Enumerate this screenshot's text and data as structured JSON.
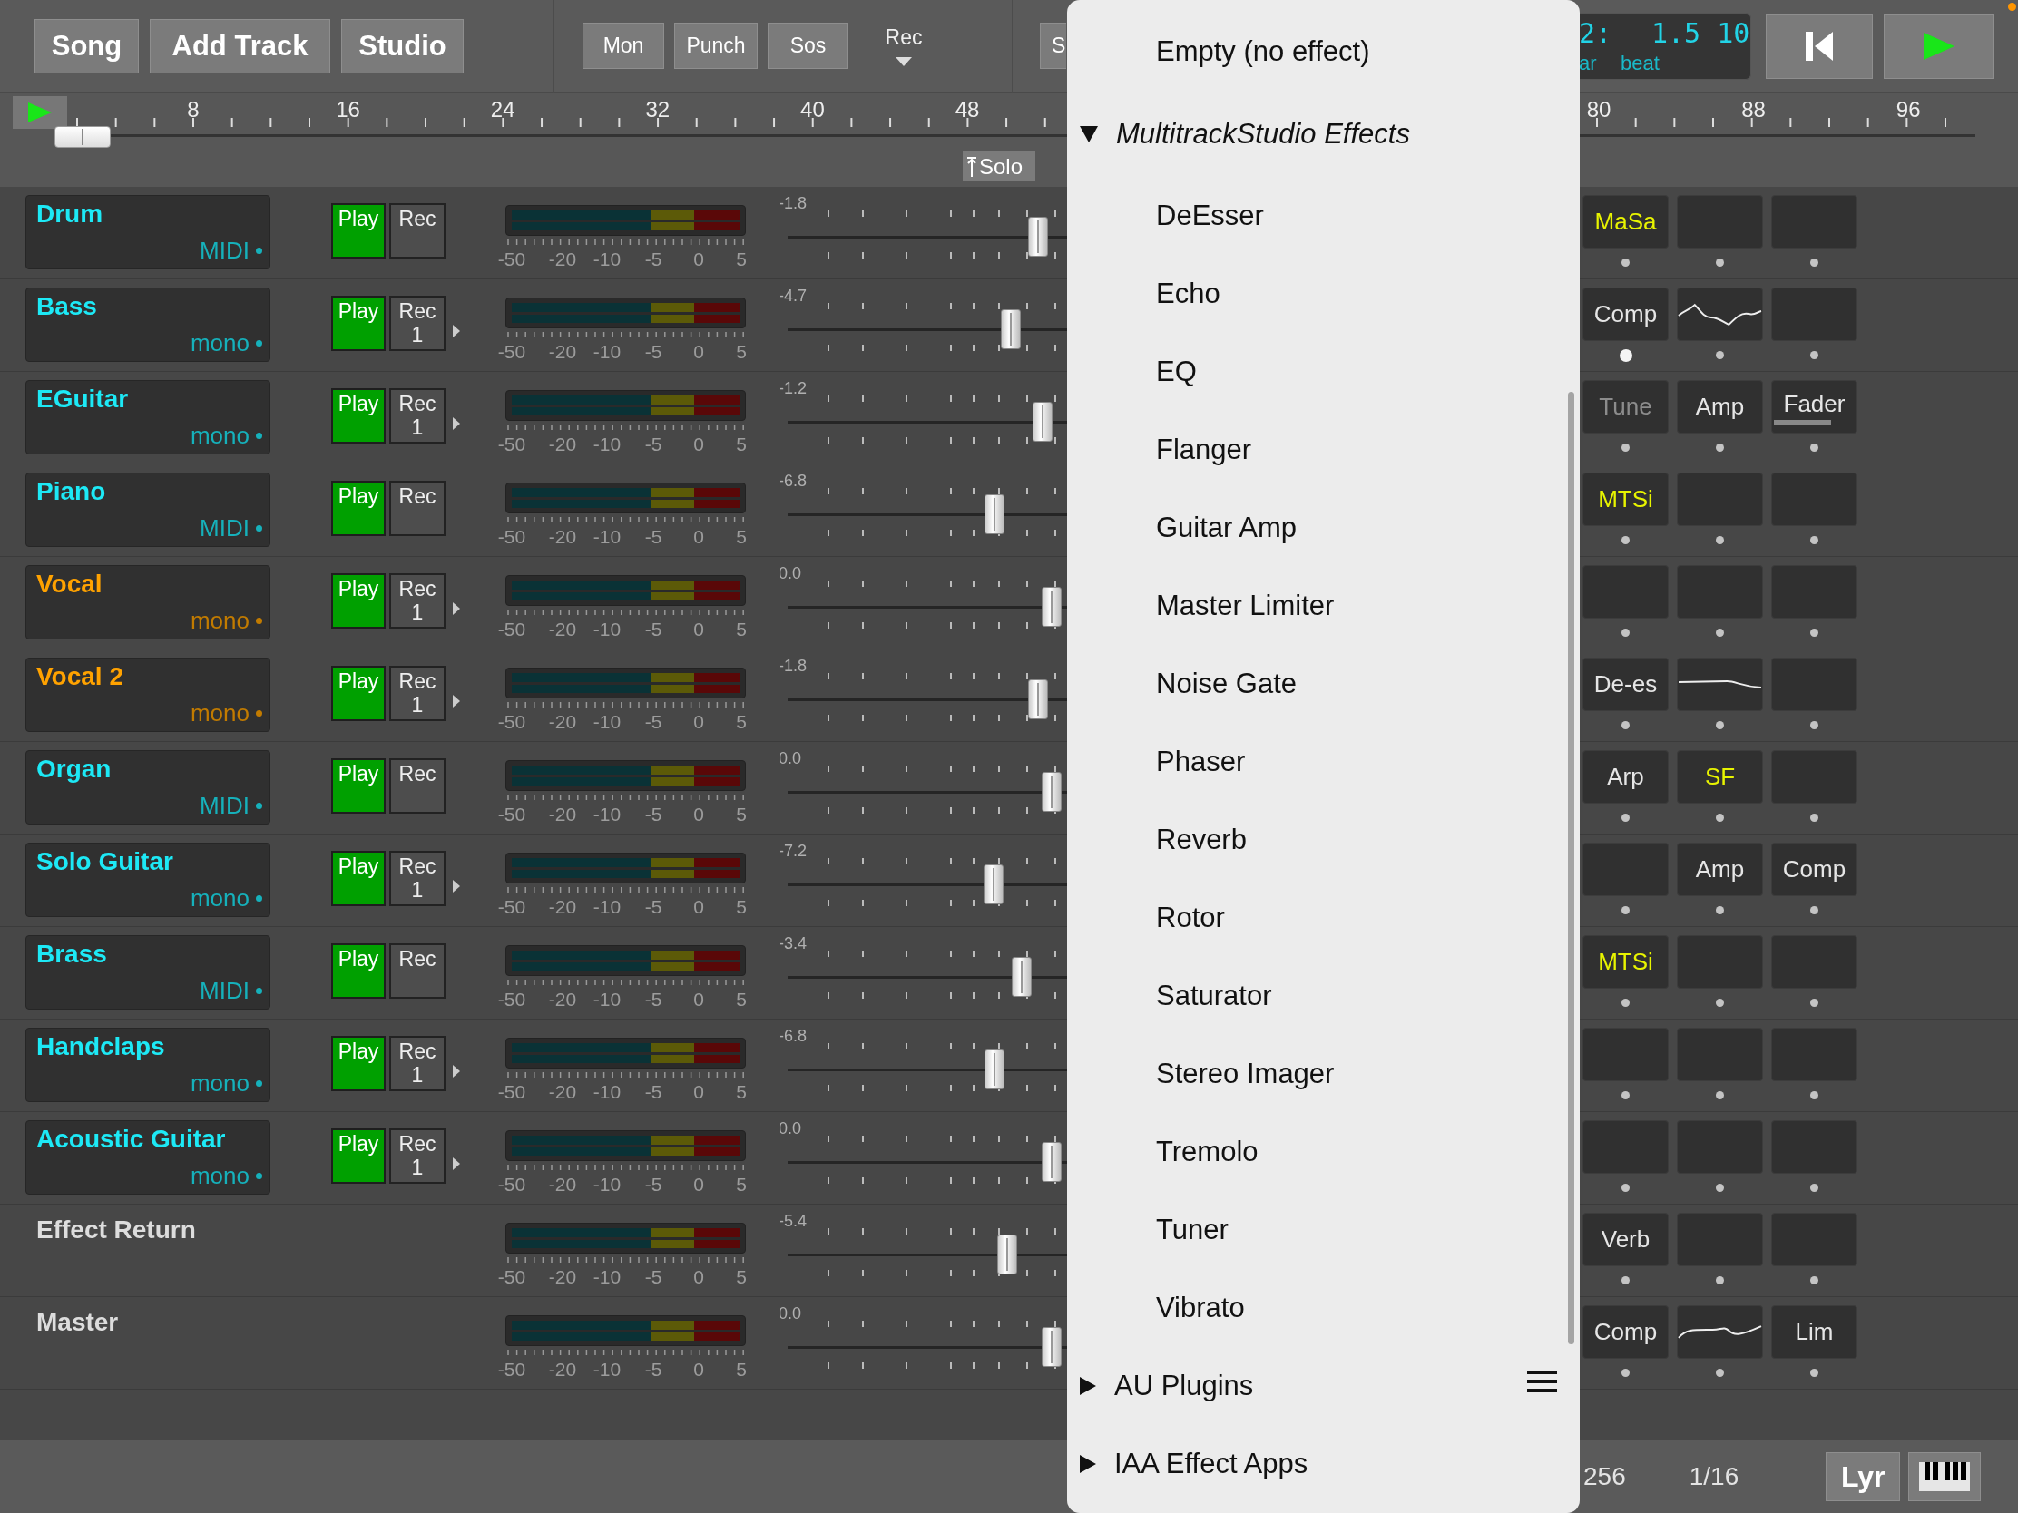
{
  "toolbar": {
    "main_buttons": [
      "Song",
      "Add Track",
      "Studio"
    ],
    "toggles": [
      "Mon",
      "Punch",
      "Sos"
    ],
    "rec_dropdown": "Rec",
    "cut_button": "S"
  },
  "position_display": {
    "bar": "2:",
    "beat_value": "1.5 10",
    "bar_label": "ar",
    "beat_label": "beat"
  },
  "ruler": {
    "left_labels": [
      "8",
      "16",
      "24",
      "32",
      "40",
      "48"
    ],
    "right_labels": [
      "80",
      "88",
      "96"
    ],
    "solo_button": "Solo"
  },
  "tracks": [
    {
      "kind": "track",
      "name": "Drum",
      "color": "#1de9f6",
      "type": "MIDI",
      "play_label": "Play",
      "play": true,
      "rec_label": "Rec",
      "rec_armed": false,
      "meter_scale": [
        "-50",
        "-20",
        "-10",
        "-5",
        "0",
        "5"
      ],
      "reading": "-1.8",
      "level": 0.92,
      "slots": [
        {
          "kind": "label",
          "label": "MaSa",
          "color": "#e8f400",
          "active": false
        },
        {
          "kind": "empty",
          "active": false
        },
        {
          "kind": "empty",
          "active": false
        }
      ]
    },
    {
      "kind": "track",
      "name": "Bass",
      "color": "#1de9f6",
      "type": "mono",
      "play_label": "Play",
      "play": true,
      "rec_label": "Rec",
      "rec_input": "1",
      "rec_armed": false,
      "meter_scale": [
        "-50",
        "-20",
        "-10",
        "-5",
        "0",
        "5"
      ],
      "reading": "-4.7",
      "level": 0.82,
      "slots": [
        {
          "kind": "label",
          "label": "Comp",
          "color": "#e6e6e6",
          "active": true
        },
        {
          "kind": "bumpy",
          "active": false
        },
        {
          "kind": "empty",
          "active": false
        }
      ]
    },
    {
      "kind": "track",
      "name": "EGuitar",
      "color": "#1de9f6",
      "type": "mono",
      "play_label": "Play",
      "play": true,
      "rec_label": "Rec",
      "rec_input": "1",
      "rec_armed": false,
      "meter_scale": [
        "-50",
        "-20",
        "-10",
        "-5",
        "0",
        "5"
      ],
      "reading": "-1.2",
      "level": 0.935,
      "slots": [
        {
          "kind": "label",
          "label": "Tune",
          "color": "#8c8c8c",
          "active": false
        },
        {
          "kind": "label",
          "label": "Amp",
          "color": "#e6e6e6",
          "active": false
        },
        {
          "kind": "label",
          "label": "Fader",
          "color": "#e6e6e6",
          "level": 0.7,
          "active": false
        }
      ]
    },
    {
      "kind": "track",
      "name": "Piano",
      "color": "#1de9f6",
      "type": "MIDI",
      "play_label": "Play",
      "play": true,
      "rec_label": "Rec",
      "rec_armed": false,
      "meter_scale": [
        "-50",
        "-20",
        "-10",
        "-5",
        "0",
        "5"
      ],
      "reading": "-6.8",
      "level": 0.76,
      "slots": [
        {
          "kind": "label",
          "label": "MTSi",
          "color": "#e8f400",
          "active": false
        },
        {
          "kind": "empty",
          "active": false
        },
        {
          "kind": "empty",
          "active": false
        }
      ]
    },
    {
      "kind": "track",
      "name": "Vocal",
      "color": "#ffa200",
      "type": "mono",
      "play_label": "Play",
      "play": true,
      "rec_label": "Rec",
      "rec_input": "1",
      "rec_armed": false,
      "meter_scale": [
        "-50",
        "-20",
        "-10",
        "-5",
        "0",
        "5"
      ],
      "reading": "0.0",
      "level": 0.97,
      "slots": [
        {
          "kind": "empty",
          "active": false
        },
        {
          "kind": "empty",
          "active": false
        },
        {
          "kind": "empty",
          "active": false
        }
      ]
    },
    {
      "kind": "track",
      "name": "Vocal 2",
      "color": "#ffa200",
      "type": "mono",
      "play_label": "Play",
      "play": true,
      "rec_label": "Rec",
      "rec_input": "1",
      "rec_armed": false,
      "meter_scale": [
        "-50",
        "-20",
        "-10",
        "-5",
        "0",
        "5"
      ],
      "reading": "-1.8",
      "level": 0.92,
      "slots": [
        {
          "kind": "label",
          "label": "De-es",
          "color": "#e6e6e6",
          "active": false
        },
        {
          "kind": "rolloff",
          "active": false
        },
        {
          "kind": "empty",
          "active": false
        }
      ]
    },
    {
      "kind": "track",
      "name": "Organ",
      "color": "#1de9f6",
      "type": "MIDI",
      "play_label": "Play",
      "play": true,
      "rec_label": "Rec",
      "rec_armed": false,
      "meter_scale": [
        "-50",
        "-20",
        "-10",
        "-5",
        "0",
        "5"
      ],
      "reading": "0.0",
      "level": 0.97,
      "slots": [
        {
          "kind": "label",
          "label": "Arp",
          "color": "#e6e6e6",
          "active": false
        },
        {
          "kind": "label",
          "label": "SF",
          "color": "#e8f400",
          "active": false
        },
        {
          "kind": "empty",
          "active": false
        }
      ]
    },
    {
      "kind": "track",
      "name": "Solo Guitar",
      "color": "#1de9f6",
      "type": "mono",
      "play_label": "Play",
      "play": true,
      "rec_label": "Rec",
      "rec_input": "1",
      "rec_armed": false,
      "meter_scale": [
        "-50",
        "-20",
        "-10",
        "-5",
        "0",
        "5"
      ],
      "reading": "-7.2",
      "level": 0.755,
      "slots": [
        {
          "kind": "empty",
          "active": false
        },
        {
          "kind": "label",
          "label": "Amp",
          "color": "#e6e6e6",
          "active": false
        },
        {
          "kind": "label",
          "label": "Comp",
          "color": "#e6e6e6",
          "active": false
        }
      ]
    },
    {
      "kind": "track",
      "name": "Brass",
      "color": "#1de9f6",
      "type": "MIDI",
      "play_label": "Play",
      "play": true,
      "rec_label": "Rec",
      "rec_armed": false,
      "meter_scale": [
        "-50",
        "-20",
        "-10",
        "-5",
        "0",
        "5"
      ],
      "reading": "-3.4",
      "level": 0.86,
      "slots": [
        {
          "kind": "label",
          "label": "MTSi",
          "color": "#e8f400",
          "active": false
        },
        {
          "kind": "empty",
          "active": false
        },
        {
          "kind": "empty",
          "active": false
        }
      ]
    },
    {
      "kind": "track",
      "name": "Handclaps",
      "color": "#1de9f6",
      "type": "mono",
      "play_label": "Play",
      "play": true,
      "rec_label": "Rec",
      "rec_input": "1",
      "rec_armed": false,
      "meter_scale": [
        "-50",
        "-20",
        "-10",
        "-5",
        "0",
        "5"
      ],
      "reading": "-6.8",
      "level": 0.76,
      "slots": [
        {
          "kind": "empty",
          "active": false
        },
        {
          "kind": "empty",
          "active": false
        },
        {
          "kind": "empty",
          "active": false
        }
      ]
    },
    {
      "kind": "track",
      "name": "Acoustic Guitar",
      "color": "#1de9f6",
      "type": "mono",
      "play_label": "Play",
      "play": true,
      "rec_label": "Rec",
      "rec_input": "1",
      "rec_armed": false,
      "meter_scale": [
        "-50",
        "-20",
        "-10",
        "-5",
        "0",
        "5"
      ],
      "reading": "0.0",
      "level": 0.97,
      "slots": [
        {
          "kind": "empty",
          "active": false
        },
        {
          "kind": "empty",
          "active": false
        },
        {
          "kind": "empty",
          "active": false
        }
      ]
    },
    {
      "kind": "bus",
      "name": "Effect Return",
      "meter_scale": [
        "-50",
        "-20",
        "-10",
        "-5",
        "0",
        "5"
      ],
      "reading": "-5.4",
      "level": 0.805,
      "slots": [
        {
          "kind": "label",
          "label": "Verb",
          "color": "#e6e6e6",
          "active": false
        },
        {
          "kind": "empty",
          "active": false
        },
        {
          "kind": "empty",
          "active": false
        }
      ]
    },
    {
      "kind": "bus",
      "name": "Master",
      "meter_scale": [
        "-50",
        "-20",
        "-10",
        "-5",
        "0",
        "5"
      ],
      "reading": "0.0",
      "level": 0.97,
      "slots": [
        {
          "kind": "label",
          "label": "Comp",
          "color": "#e6e6e6",
          "active": false
        },
        {
          "kind": "wave",
          "active": false
        },
        {
          "kind": "label",
          "label": "Lim",
          "color": "#e6e6e6",
          "active": false
        }
      ]
    }
  ],
  "effects_menu": {
    "items": [
      {
        "kind": "option",
        "label": "Empty (no effect)"
      },
      {
        "kind": "group",
        "label": "MultitrackStudio Effects",
        "expanded": true,
        "children": [
          {
            "kind": "option",
            "label": "DeEsser"
          },
          {
            "kind": "option",
            "label": "Echo"
          },
          {
            "kind": "option",
            "label": "EQ"
          },
          {
            "kind": "option",
            "label": "Flanger"
          },
          {
            "kind": "option",
            "label": "Guitar Amp"
          },
          {
            "kind": "option",
            "label": "Master Limiter"
          },
          {
            "kind": "option",
            "label": "Noise Gate"
          },
          {
            "kind": "option",
            "label": "Phaser"
          },
          {
            "kind": "option",
            "label": "Reverb"
          },
          {
            "kind": "option",
            "label": "Rotor"
          },
          {
            "kind": "option",
            "label": "Saturator"
          },
          {
            "kind": "option",
            "label": "Stereo Imager"
          },
          {
            "kind": "option",
            "label": "Tremolo"
          },
          {
            "kind": "option",
            "label": "Tuner"
          },
          {
            "kind": "option",
            "label": "Vibrato"
          }
        ]
      },
      {
        "kind": "group",
        "label": "AU Plugins",
        "expanded": false
      },
      {
        "kind": "group",
        "label": "IAA Effect Apps",
        "expanded": false
      }
    ]
  },
  "status_bar": {
    "zoom": "256",
    "grid": "1/16",
    "lyrics_button": "Lyr"
  }
}
